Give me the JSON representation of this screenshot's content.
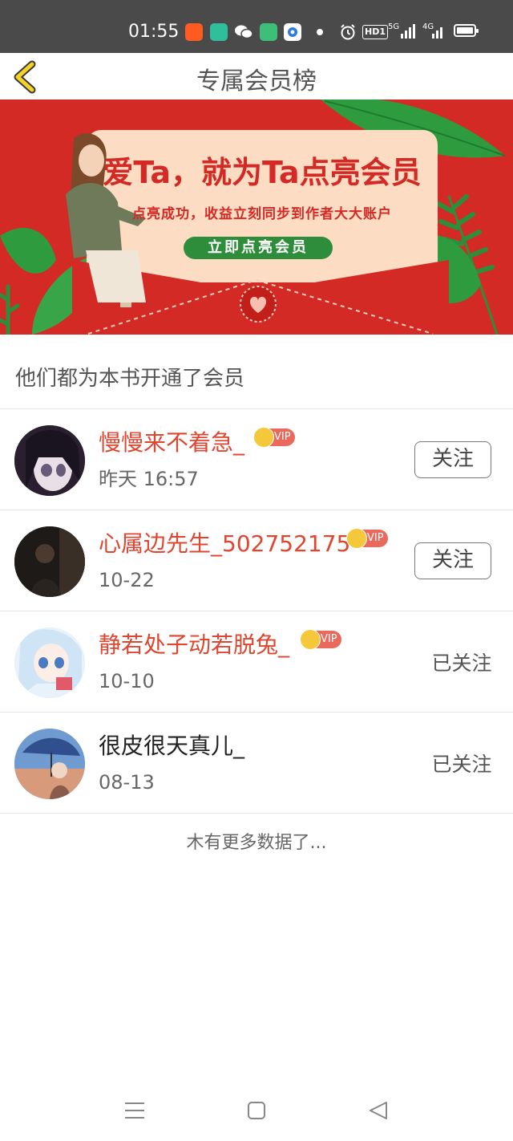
{
  "status_bar": {
    "time": "01:55",
    "hd_label": "HD1",
    "net1": "5G",
    "net2": "4G",
    "icons": [
      "app-icon",
      "chat-icon",
      "wechat-icon",
      "note-icon",
      "browser-icon",
      "dot-icon",
      "alarm-icon",
      "hd-icon",
      "signal-5g-icon",
      "signal-4g-icon",
      "battery-icon"
    ]
  },
  "header": {
    "title": "专属会员榜",
    "back_icon": "chevron-left-icon"
  },
  "banner": {
    "headline": "爱Ta，就为Ta点亮会员",
    "subtitle": "点亮成功，收益立刻同步到作者大大账户",
    "cta": "立即点亮会员",
    "colors": {
      "background": "#d42a25",
      "card": "#fcdcc2",
      "cta": "#2e8d3a"
    }
  },
  "section": {
    "title": "他们都为本书开通了会员"
  },
  "members": [
    {
      "name": "慢慢来不着急_",
      "time": "昨天 16:57",
      "vip": true,
      "vip_label": "VIP",
      "action": "关注",
      "followed": false
    },
    {
      "name": "心属边先生_502752175",
      "time": "10-22",
      "vip": true,
      "vip_label": "VIP",
      "action": "关注",
      "followed": false
    },
    {
      "name": "静若处子动若脱兔_",
      "time": "10-10",
      "vip": true,
      "vip_label": "VIP",
      "action": "已关注",
      "followed": true
    },
    {
      "name": "很皮很天真儿_",
      "time": "08-13",
      "vip": false,
      "action": "已关注",
      "followed": true
    }
  ],
  "footer": {
    "no_more": "木有更多数据了..."
  },
  "nav": {
    "icons": [
      "menu-icon",
      "home-square-icon",
      "back-triangle-icon"
    ]
  },
  "colors": {
    "vip_name": "#e0452f",
    "vip_badge": "#e96a5c",
    "crown": "#f5c83b",
    "status_bar": "#4a4a4a"
  }
}
